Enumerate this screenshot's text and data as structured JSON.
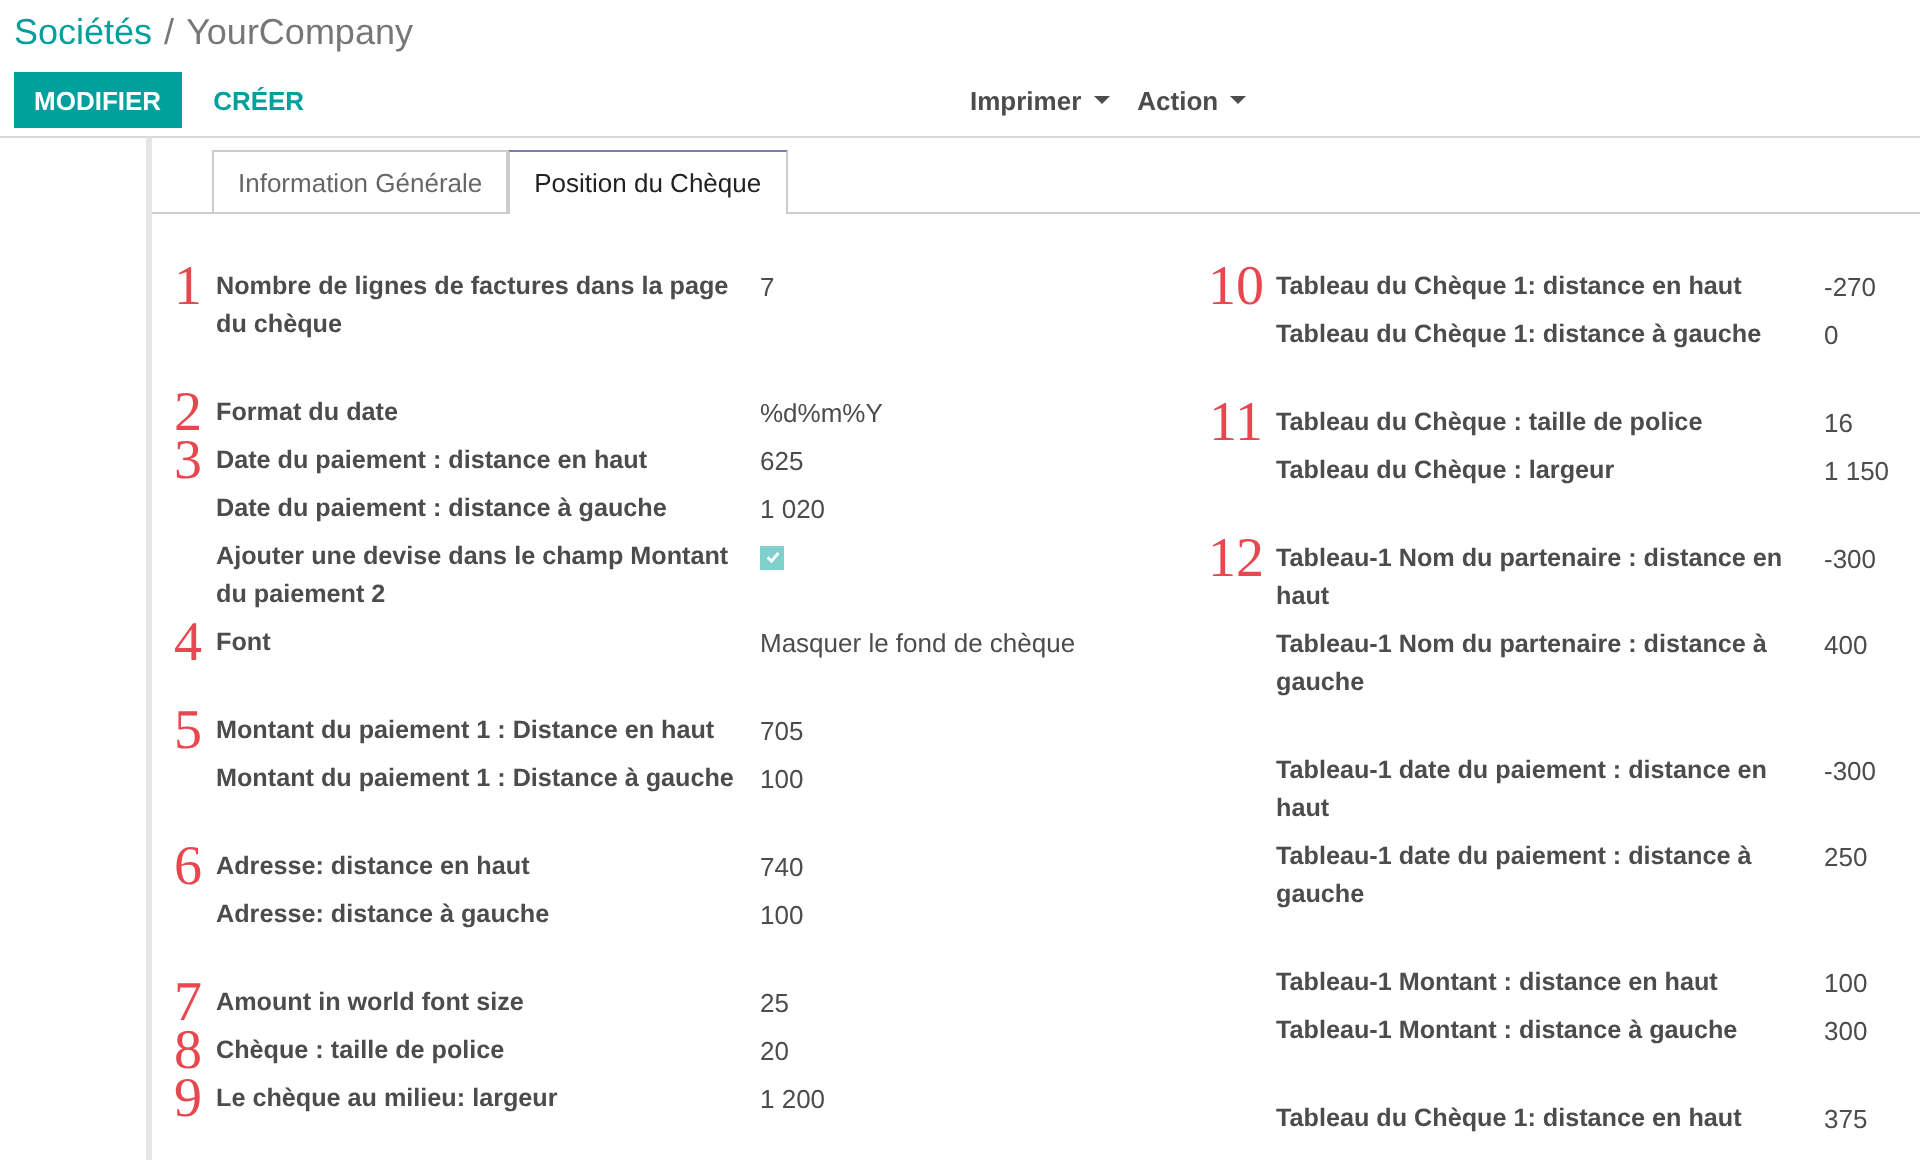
{
  "breadcrumb": {
    "parent": "Sociétés",
    "separator": "/",
    "current": "YourCompany"
  },
  "buttons": [
    {
      "label": "MODIFIER",
      "kind": "primary"
    },
    {
      "label": "CRÉER",
      "kind": "link"
    }
  ],
  "menus": [
    {
      "label": "Imprimer"
    },
    {
      "label": "Action"
    }
  ],
  "tabs": [
    {
      "label": "Information Générale",
      "selected": false
    },
    {
      "label": "Position du Chèque",
      "selected": true
    }
  ],
  "columns": [
    {
      "groups": [
        {
          "rows": [
            {
              "marker": "1",
              "label": "Nombre de lignes de factures dans la page du chèque",
              "kind": "text",
              "value": "7"
            }
          ]
        },
        {
          "rows": [
            {
              "marker": "2",
              "label": "Format du date",
              "kind": "text",
              "value": "%d%m%Y"
            },
            {
              "marker": "3",
              "label": "Date du paiement : distance en haut",
              "kind": "text",
              "value": "625"
            },
            {
              "label": "Date du paiement : distance à gauche",
              "kind": "text",
              "value": "1 020"
            },
            {
              "label": "Ajouter une devise dans le champ Montant du paiement 2",
              "kind": "checkbox",
              "checked": true
            },
            {
              "marker": "4",
              "label": "Font",
              "kind": "text",
              "value": "Masquer le fond de chèque"
            }
          ]
        },
        {
          "rows": [
            {
              "marker": "5",
              "label": "Montant du paiement 1 : Distance en haut",
              "kind": "text",
              "value": "705"
            },
            {
              "label": "Montant du paiement 1 : Distance à gauche",
              "kind": "text",
              "value": "100"
            }
          ]
        },
        {
          "rows": [
            {
              "marker": "6",
              "label": "Adresse: distance en haut",
              "kind": "text",
              "value": "740"
            },
            {
              "label": "Adresse: distance à gauche",
              "kind": "text",
              "value": "100"
            }
          ]
        },
        {
          "rows": [
            {
              "marker": "7",
              "label": "Amount in world font size",
              "kind": "text",
              "value": "25"
            },
            {
              "marker": "8",
              "label": "Chèque : taille de police",
              "kind": "text",
              "value": "20"
            },
            {
              "marker": "9",
              "label": "Le chèque au milieu: largeur",
              "kind": "text",
              "value": "1 200"
            }
          ]
        }
      ]
    },
    {
      "groups": [
        {
          "rows": [
            {
              "marker": "10",
              "label": "Tableau du Chèque 1: distance en haut",
              "kind": "text",
              "value": "-270"
            },
            {
              "label": "Tableau du Chèque 1: distance à gauche",
              "kind": "text",
              "value": "0"
            }
          ]
        },
        {
          "rows": [
            {
              "marker": "11",
              "label": "Tableau du Chèque : taille de police",
              "kind": "text",
              "value": "16"
            },
            {
              "label": "Tableau du Chèque : largeur",
              "kind": "text",
              "value": "1 150"
            }
          ]
        },
        {
          "rows": [
            {
              "marker": "12",
              "label": "Tableau-1 Nom du partenaire : distance en haut",
              "kind": "text",
              "value": "-300"
            },
            {
              "label": "Tableau-1 Nom du partenaire : distance à gauche",
              "kind": "text",
              "value": "400"
            }
          ]
        },
        {
          "rows": [
            {
              "label": "Tableau-1 date du paiement : distance en haut",
              "kind": "text",
              "value": "-300"
            },
            {
              "label": "Tableau-1 date du paiement : distance à gauche",
              "kind": "text",
              "value": "250"
            }
          ]
        },
        {
          "rows": [
            {
              "label": "Tableau-1 Montant : distance en haut",
              "kind": "text",
              "value": "100"
            },
            {
              "label": "Tableau-1 Montant : distance à gauche",
              "kind": "text",
              "value": "300"
            }
          ]
        },
        {
          "rows": [
            {
              "label": "Tableau du Chèque 1: distance en haut",
              "kind": "text",
              "value": "375"
            }
          ]
        }
      ]
    }
  ]
}
